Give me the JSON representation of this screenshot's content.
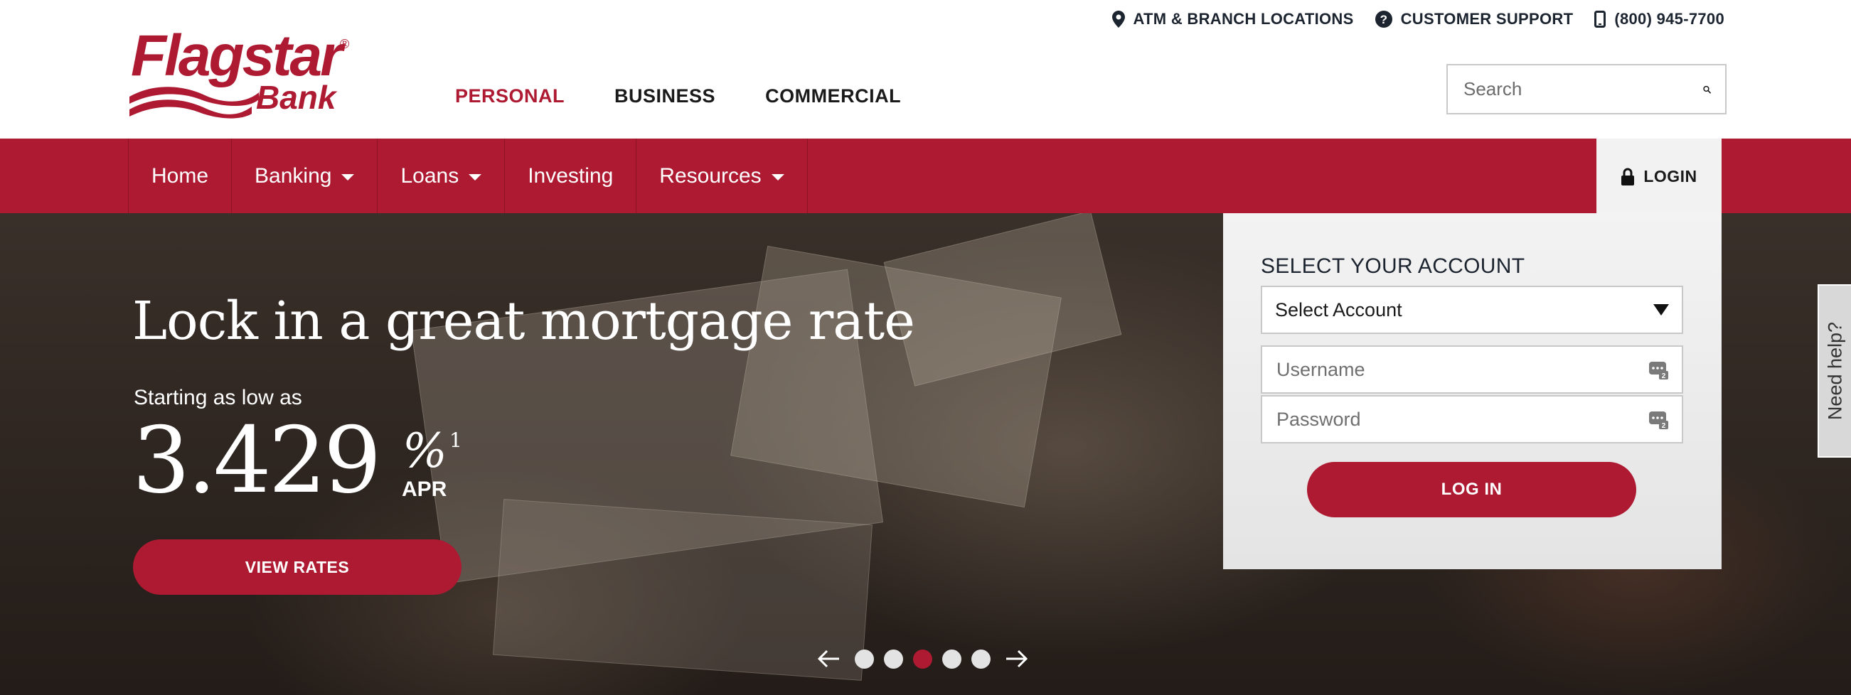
{
  "brand": {
    "name": "Flagstar",
    "sub": "Bank",
    "reg": "®",
    "color": "#ad1a31"
  },
  "utility": {
    "locations": "ATM & BRANCH LOCATIONS",
    "support": "CUSTOMER SUPPORT",
    "phone": "(800) 945-7700"
  },
  "segments": [
    {
      "label": "PERSONAL",
      "active": true
    },
    {
      "label": "BUSINESS",
      "active": false
    },
    {
      "label": "COMMERCIAL",
      "active": false
    }
  ],
  "search": {
    "placeholder": "Search"
  },
  "nav": {
    "items": [
      {
        "label": "Home",
        "dropdown": false
      },
      {
        "label": "Banking",
        "dropdown": true
      },
      {
        "label": "Loans",
        "dropdown": true
      },
      {
        "label": "Investing",
        "dropdown": false
      },
      {
        "label": "Resources",
        "dropdown": true
      }
    ],
    "login": "LOGIN"
  },
  "hero": {
    "title": "Lock in a great mortgage rate",
    "subtitle": "Starting as low as",
    "rate": "3.429",
    "percent": "%",
    "footnote": "1",
    "apr": "APR",
    "cta": "VIEW RATES"
  },
  "carousel": {
    "slides": 5,
    "active_index": 2
  },
  "login_panel": {
    "heading": "SELECT YOUR ACCOUNT",
    "select_value": "Select Account",
    "username_placeholder": "Username",
    "password_placeholder": "Password",
    "button": "LOG IN"
  },
  "help": {
    "label": "Need help?"
  },
  "icons": [
    "map-pin-icon",
    "question-circle-icon",
    "mobile-phone-icon",
    "search-icon",
    "lock-icon",
    "chevron-down-icon",
    "arrow-left-icon",
    "arrow-right-icon",
    "password-manager-icon"
  ]
}
